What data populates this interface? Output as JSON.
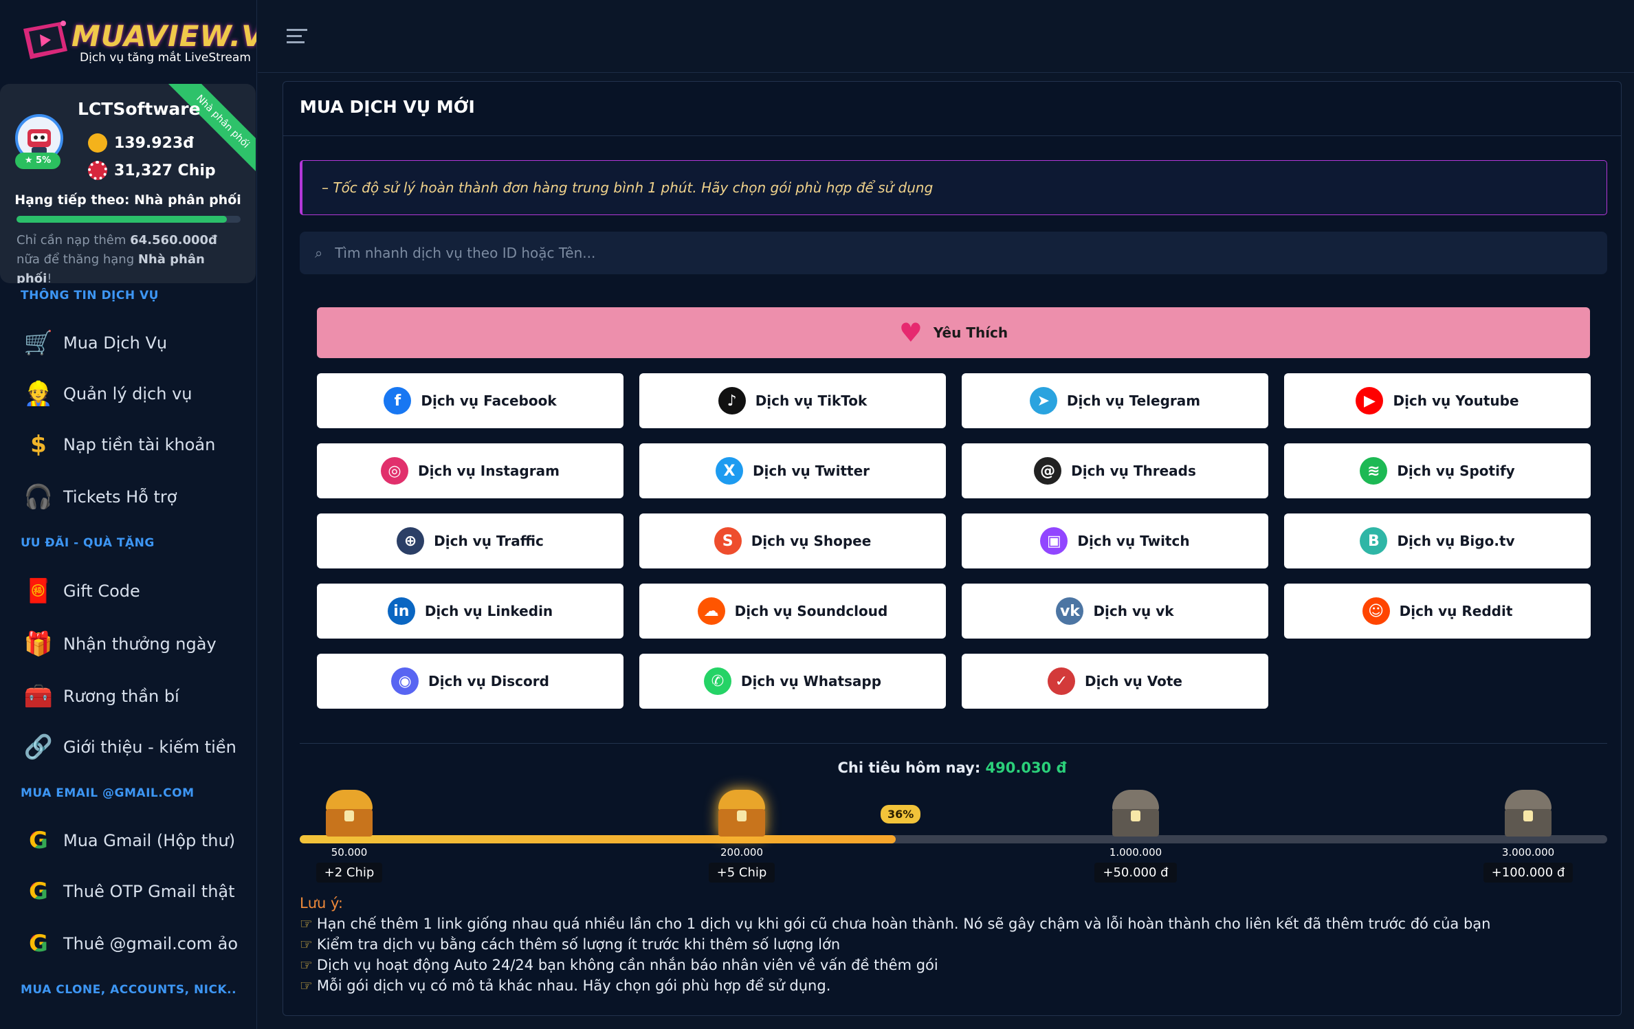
{
  "brand": {
    "name": "MUAVIEW.VN",
    "tagline": "Dịch vụ tăng mắt LiveStream"
  },
  "user": {
    "name": "LCTSoftware",
    "ribbon": "Nhà phân phối",
    "level": "★ 5%",
    "balance": "139.923đ",
    "chips": "31,327 Chip",
    "next_rank": "Hạng tiếp theo: Nhà phân phối",
    "progress": 0.94,
    "need_prefix": "Chỉ cần nạp thêm ",
    "need_amount": "64.560.000đ",
    "need_mid": " nữa để thăng hạng ",
    "need_rank": "Nhà phân phối",
    "need_suffix": "!"
  },
  "sidebar": {
    "sections": [
      "THÔNG TIN DỊCH VỤ",
      "ƯU ĐÃI - QUÀ TẶNG",
      "MUA EMAIL @GMAIL.COM",
      "MUA CLONE, ACCOUNTS, NICK.."
    ],
    "items": [
      "Mua Dịch Vụ",
      "Quản lý dịch vụ",
      "Nạp tiền tài khoản",
      "Tickets Hỗ trợ",
      "Gift Code",
      "Nhận thưởng ngày",
      "Rương thần bí",
      "Giới thiệu - kiếm tiền",
      "Mua Gmail (Hộp thư)",
      "Thuê OTP Gmail thật",
      "Thuê @gmail.com ảo"
    ]
  },
  "main": {
    "title": "MUA DỊCH VỤ MỚI",
    "notice": "– Tốc độ sử lý hoàn thành đơn hàng trung bình 1 phút. Hãy chọn gói phù hợp để sử dụng",
    "search_placeholder": "Tìm nhanh dịch vụ theo ID hoặc Tên...",
    "favorite": "Yêu Thích",
    "services": [
      {
        "label": "Dịch vụ Facebook",
        "color": "#1877f2",
        "glyph": "f"
      },
      {
        "label": "Dịch vụ TikTok",
        "color": "#111111",
        "glyph": "♪"
      },
      {
        "label": "Dịch vụ Telegram",
        "color": "#2aa3df",
        "glyph": "➤"
      },
      {
        "label": "Dịch vụ Youtube",
        "color": "#ff0000",
        "glyph": "▶"
      },
      {
        "label": "Dịch vụ Instagram",
        "color": "#e1306c",
        "glyph": "◎"
      },
      {
        "label": "Dịch vụ Twitter",
        "color": "#1d9bf0",
        "glyph": "X"
      },
      {
        "label": "Dịch vụ Threads",
        "color": "#222222",
        "glyph": "@"
      },
      {
        "label": "Dịch vụ Spotify",
        "color": "#1db954",
        "glyph": "≋"
      },
      {
        "label": "Dịch vụ Traffic",
        "color": "#2b3f66",
        "glyph": "⊕"
      },
      {
        "label": "Dịch vụ Shopee",
        "color": "#ee4d2d",
        "glyph": "S"
      },
      {
        "label": "Dịch vụ Twitch",
        "color": "#9146ff",
        "glyph": "▣"
      },
      {
        "label": "Dịch vụ Bigo.tv",
        "color": "#2fb6a6",
        "glyph": "B"
      },
      {
        "label": "Dịch vụ Linkedin",
        "color": "#0a66c2",
        "glyph": "in"
      },
      {
        "label": "Dịch vụ Soundcloud",
        "color": "#ff5500",
        "glyph": "☁"
      },
      {
        "label": "Dịch vụ vk",
        "color": "#4c75a3",
        "glyph": "vk"
      },
      {
        "label": "Dịch vụ Reddit",
        "color": "#ff4500",
        "glyph": "☺"
      },
      {
        "label": "Dịch vụ Discord",
        "color": "#5865f2",
        "glyph": "◉"
      },
      {
        "label": "Dịch vụ Whatsapp",
        "color": "#25d366",
        "glyph": "✆"
      },
      {
        "label": "Dịch vụ Vote",
        "color": "#d33a3a",
        "glyph": "✓"
      }
    ],
    "spend_label": "Chi tiêu hôm nay: ",
    "spend_value": "490.030 đ",
    "progress_label": "36%",
    "progress_fill": 0.456,
    "milestones": [
      {
        "amount": "50.000",
        "reward": "+2 Chip"
      },
      {
        "amount": "200.000",
        "reward": "+5 Chip"
      },
      {
        "amount": "1.000.000",
        "reward": "+50.000 đ"
      },
      {
        "amount": "3.000.000",
        "reward": "+100.000 đ"
      }
    ],
    "notes_title": "Lưu ý:",
    "notes": [
      "Hạn chế thêm 1 link giống nhau quá nhiều lần cho 1 dịch vụ khi gói cũ chưa hoàn thành. Nó sẽ gây chậm và lỗi hoàn thành cho liên kết đã thêm trước đó của bạn",
      "Kiểm tra dịch vụ bằng cách thêm số lượng ít trước khi thêm số lượng lớn",
      "Dịch vụ hoạt động Auto 24/24 bạn không cần nhắn báo nhân viên về vấn đề thêm gói",
      "Mỗi gói dịch vụ có mô tả khác nhau. Hãy chọn gói phù hợp để sử dụng."
    ]
  },
  "colors": {
    "accent": "#3d96f4",
    "success": "#2bd07a",
    "favorite": "#ed8fac",
    "alert_border": "#b337d8"
  }
}
